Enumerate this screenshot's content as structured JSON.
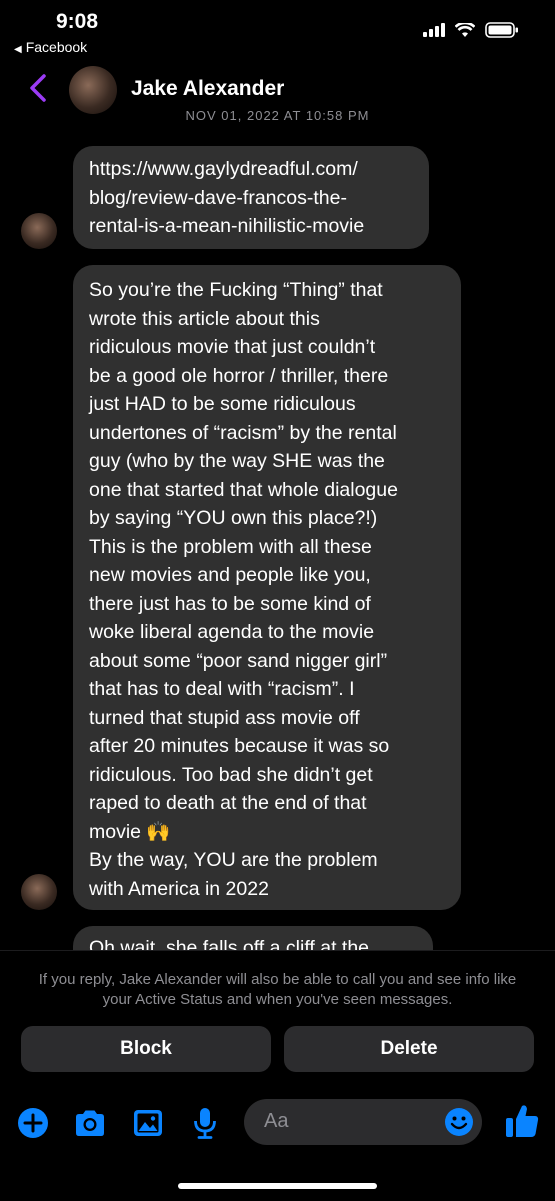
{
  "status_bar": {
    "time": "9:08",
    "back_app": "Facebook"
  },
  "header": {
    "contact_name": "Jake Alexander",
    "date_separator": "NOV 01, 2022 AT 10:58 PM"
  },
  "messages": [
    {
      "text": "https://www.gaylydreadful.com/\nblog/review-dave-francos-the-\nrental-is-a-mean-nihilistic-movie"
    },
    {
      "text": "So you’re the Fucking “Thing” that\nwrote this article about this\nridiculous movie that just couldn’t\nbe a good ole horror / thriller, there\njust HAD to be some ridiculous\nundertones of “racism” by the rental\nguy (who by the way SHE was the\none that started that whole dialogue\nby saying “YOU own this place?!)\nThis is the problem with all these\nnew movies and people like you,\nthere just has to be some kind of\nwoke liberal agenda to the movie\nabout some “poor sand nigger girl”\nthat has to deal with “racism”. I\nturned that stupid ass movie off\nafter 20 minutes because it was so\nridiculous. Too bad she didn’t get\nraped to death at the end of that\nmovie 🙌\nBy the way, YOU are the problem\nwith America in 2022"
    },
    {
      "text": "Oh wait, she falls off a cliff at the"
    }
  ],
  "bottom": {
    "notice": "If you reply, Jake Alexander will also be able to call you and see info like your Active Status and when you've seen messages.",
    "block_label": "Block",
    "delete_label": "Delete",
    "input_placeholder": "Aa"
  },
  "icons": [
    "chevron-left-icon",
    "plus-icon",
    "camera-icon",
    "photo-icon",
    "microphone-icon",
    "emoji-icon",
    "thumbs-up-icon"
  ],
  "colors": {
    "accent_purple": "#9b3bf5",
    "accent_blue": "#0a84ff",
    "bubble": "#303030"
  }
}
